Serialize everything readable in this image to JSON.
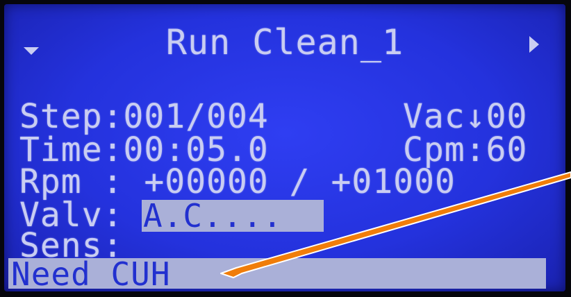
{
  "screen": {
    "title": "Run Clean_1",
    "step": "Step:001/004",
    "vac": "Vac↓00",
    "time": "Time:00:05.0",
    "cpm": "Cpm:60",
    "rpm": "Rpm : +00000 / +01000",
    "valv_label": "Valv:",
    "valv_value": "A.C....",
    "sens": "Sens:",
    "status": "Need CUH"
  },
  "icons": {
    "menu_down": "triangle-down-icon",
    "next": "triangle-right-icon"
  },
  "colors": {
    "lcd_background": "#2432dd",
    "lcd_text": "#c9cdf2",
    "highlight": "#aab0d8",
    "callout_arrow": "#f07d0a"
  }
}
